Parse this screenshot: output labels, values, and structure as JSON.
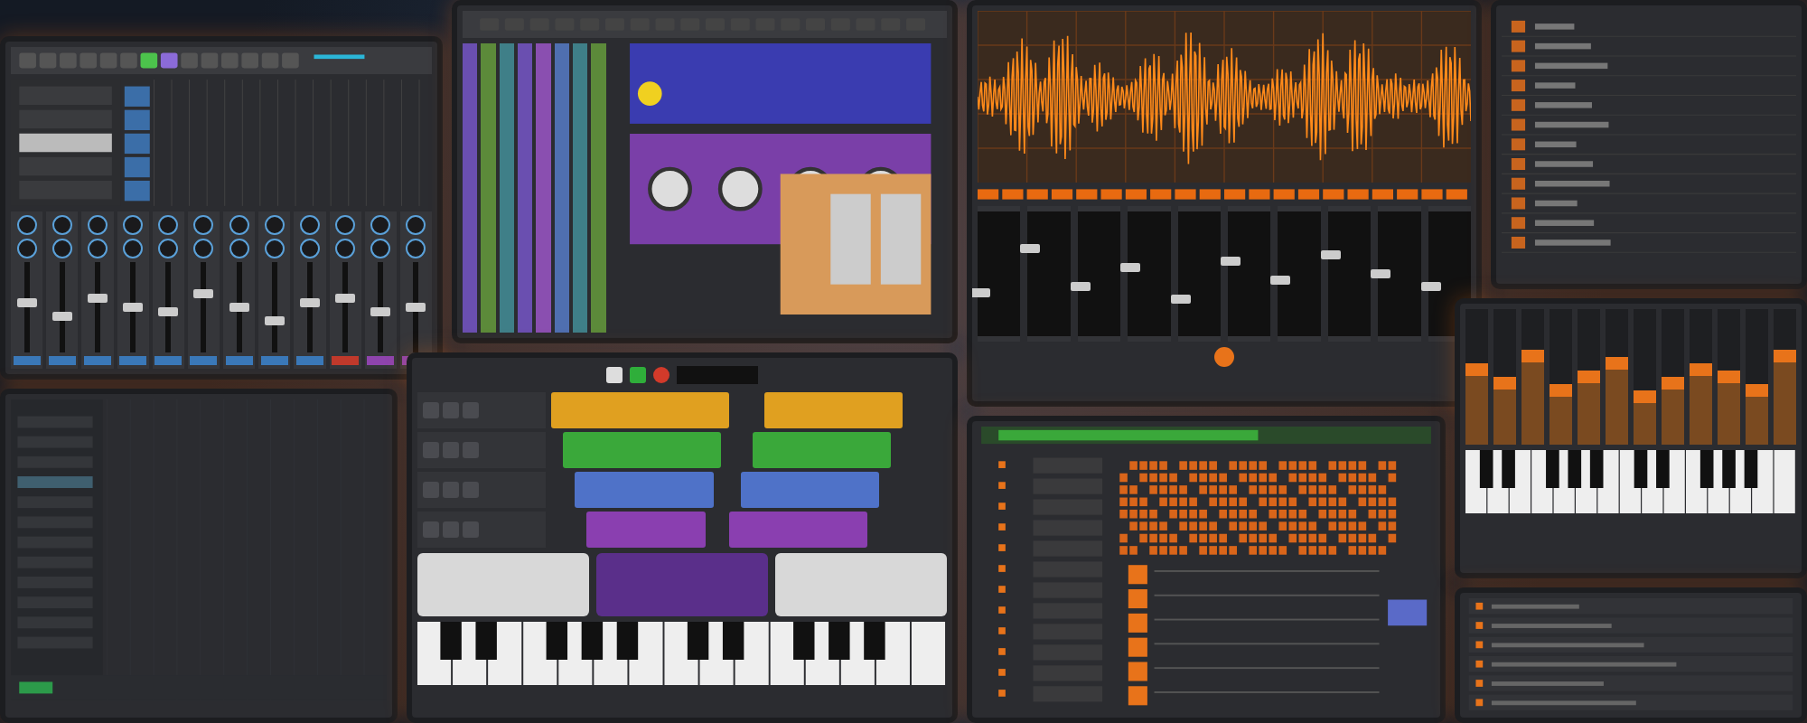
{
  "mixer": {
    "channels": [
      {
        "level": 0.55,
        "color": "#3a78b8"
      },
      {
        "level": 0.4,
        "color": "#3a78b8"
      },
      {
        "level": 0.6,
        "color": "#3a78b8"
      },
      {
        "level": 0.5,
        "color": "#3a78b8"
      },
      {
        "level": 0.45,
        "color": "#3a78b8"
      },
      {
        "level": 0.65,
        "color": "#3a78b8"
      },
      {
        "level": 0.5,
        "color": "#3a78b8"
      },
      {
        "level": 0.35,
        "color": "#3a78b8"
      },
      {
        "level": 0.55,
        "color": "#3a78b8"
      },
      {
        "level": 0.6,
        "color": "#c0392b"
      },
      {
        "level": 0.45,
        "color": "#8e44ad"
      },
      {
        "level": 0.5,
        "color": "#8e44ad"
      }
    ]
  },
  "studio": {
    "channels": [
      {
        "color": "#6a4fb0"
      },
      {
        "color": "#5c8a3a"
      },
      {
        "color": "#3f7f88"
      },
      {
        "color": "#6a4fb0"
      },
      {
        "color": "#8a4fb0"
      },
      {
        "color": "#4f6fb0"
      },
      {
        "color": "#3f7f88"
      },
      {
        "color": "#5c8a3a"
      }
    ]
  },
  "waveform": {
    "faders": [
      {
        "level": 0.35
      },
      {
        "level": 0.7
      },
      {
        "level": 0.4
      },
      {
        "level": 0.55
      },
      {
        "level": 0.3
      },
      {
        "level": 0.6
      },
      {
        "level": 0.45
      },
      {
        "level": 0.65
      },
      {
        "level": 0.5
      },
      {
        "level": 0.4
      }
    ]
  },
  "arranger": {
    "tracks": [
      {
        "color": "#e0a020"
      },
      {
        "color": "#3aa83a"
      },
      {
        "color": "#4f72c8"
      },
      {
        "color": "#8a3fb0"
      }
    ]
  },
  "synth": {
    "faders": [
      {
        "level": 0.6
      },
      {
        "level": 0.5
      },
      {
        "level": 0.7
      },
      {
        "level": 0.45
      },
      {
        "level": 0.55
      },
      {
        "level": 0.65
      },
      {
        "level": 0.4
      },
      {
        "level": 0.5
      },
      {
        "level": 0.6
      },
      {
        "level": 0.55
      },
      {
        "level": 0.45
      },
      {
        "level": 0.7
      }
    ]
  }
}
